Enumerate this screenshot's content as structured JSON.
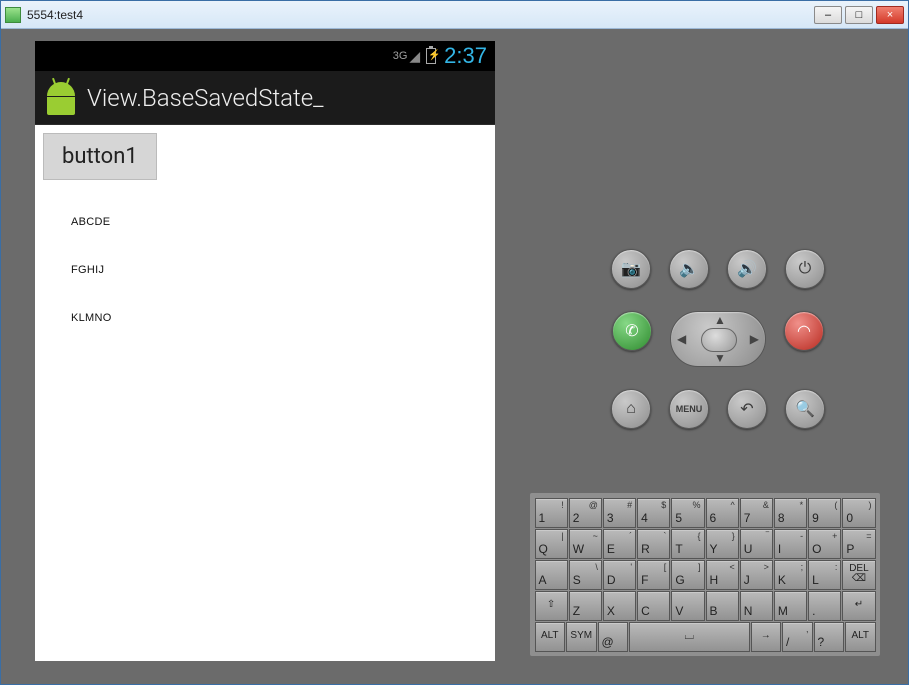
{
  "window": {
    "title": "5554:test4",
    "minimize": "–",
    "maximize": "□",
    "close": "×"
  },
  "statusbar": {
    "signal_label": "3G",
    "time": "2:37"
  },
  "appbar": {
    "title": "View.BaseSavedState_"
  },
  "app": {
    "button_label": "button1",
    "list_items": [
      "ABCDE",
      "FGHIJ",
      "KLMNO"
    ]
  },
  "controls": {
    "row1": [
      "camera",
      "volume-down",
      "volume-up",
      "power"
    ],
    "row2_left": "call",
    "row2_right": "endcall",
    "row3": [
      "home",
      "menu",
      "back",
      "search"
    ],
    "menu_label": "MENU"
  },
  "keyboard": {
    "row1": [
      {
        "main": "1",
        "sup": "!"
      },
      {
        "main": "2",
        "sup": "@"
      },
      {
        "main": "3",
        "sup": "#"
      },
      {
        "main": "4",
        "sup": "$"
      },
      {
        "main": "5",
        "sup": "%"
      },
      {
        "main": "6",
        "sup": "^"
      },
      {
        "main": "7",
        "sup": "&"
      },
      {
        "main": "8",
        "sup": "*"
      },
      {
        "main": "9",
        "sup": "("
      },
      {
        "main": "0",
        "sup": ")"
      }
    ],
    "row2": [
      {
        "main": "Q",
        "sup": "|"
      },
      {
        "main": "W",
        "sup": "~"
      },
      {
        "main": "E",
        "sup": "´"
      },
      {
        "main": "R",
        "sup": "`"
      },
      {
        "main": "T",
        "sup": "{"
      },
      {
        "main": "Y",
        "sup": "}"
      },
      {
        "main": "U",
        "sup": "‾"
      },
      {
        "main": "I",
        "sup": "-"
      },
      {
        "main": "O",
        "sup": "+"
      },
      {
        "main": "P",
        "sup": "="
      }
    ],
    "row3": [
      {
        "main": "A",
        "sup": ""
      },
      {
        "main": "S",
        "sup": "\\"
      },
      {
        "main": "D",
        "sup": "'"
      },
      {
        "main": "F",
        "sup": "["
      },
      {
        "main": "G",
        "sup": "]"
      },
      {
        "main": "H",
        "sup": "<"
      },
      {
        "main": "J",
        "sup": ">"
      },
      {
        "main": "K",
        "sup": ";"
      },
      {
        "main": "L",
        "sup": ":"
      }
    ],
    "del_label": "DEL",
    "row4": [
      {
        "main": "Z",
        "sup": ""
      },
      {
        "main": "X",
        "sup": ""
      },
      {
        "main": "C",
        "sup": ""
      },
      {
        "main": "V",
        "sup": ""
      },
      {
        "main": "B",
        "sup": ""
      },
      {
        "main": "N",
        "sup": ""
      },
      {
        "main": "M",
        "sup": ""
      },
      {
        "main": ".",
        "sup": ""
      }
    ],
    "shift_label": "⇧",
    "enter_label": "↵",
    "alt_label": "ALT",
    "sym_label": "SYM",
    "at_label": "@",
    "space_label": "⌴",
    "arrow_label": "→",
    "slash": {
      "main": "/",
      "sup": ","
    },
    "question": {
      "main": "?",
      "sup": ""
    }
  }
}
